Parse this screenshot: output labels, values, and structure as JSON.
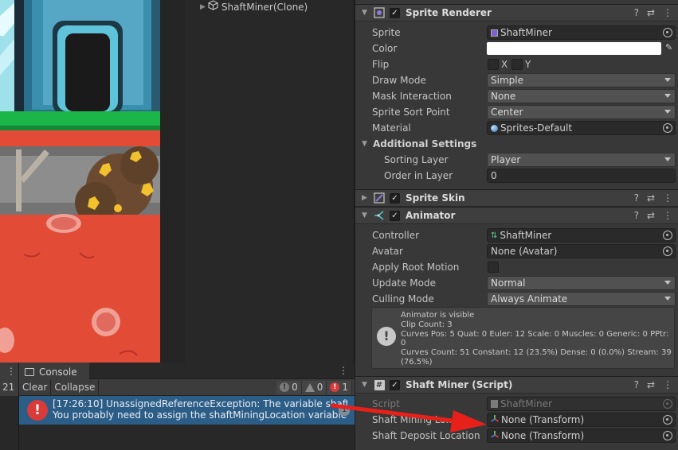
{
  "hierarchy": {
    "item": "ShaftMiner(Clone)"
  },
  "left_panel": {
    "number": "21"
  },
  "console": {
    "tab_label": "Console",
    "toolbar": {
      "clear": "Clear",
      "collapse": "Collapse",
      "log_count": "0",
      "warning_count": "0",
      "error_count": "1"
    },
    "message_line1": "[17:26:10] UnassignedReferenceException: The variable shaftMining",
    "message_line2": "You probably need to assign the shaftMiningLocation variable of the",
    "message_count": "1"
  },
  "inspector": {
    "sprite_renderer": {
      "title": "Sprite Renderer",
      "sprite_label": "Sprite",
      "sprite_value": "ShaftMiner",
      "color_label": "Color",
      "flip_label": "Flip",
      "flip_x": "X",
      "flip_y": "Y",
      "draw_mode_label": "Draw Mode",
      "draw_mode_value": "Simple",
      "mask_label": "Mask Interaction",
      "mask_value": "None",
      "sort_point_label": "Sprite Sort Point",
      "sort_point_value": "Center",
      "material_label": "Material",
      "material_value": "Sprites-Default",
      "additional_settings": "Additional Settings",
      "sorting_layer_label": "Sorting Layer",
      "sorting_layer_value": "Player",
      "order_label": "Order in Layer",
      "order_value": "0"
    },
    "sprite_skin": {
      "title": "Sprite Skin"
    },
    "animator": {
      "title": "Animator",
      "controller_label": "Controller",
      "controller_value": "ShaftMiner",
      "avatar_label": "Avatar",
      "avatar_value": "None (Avatar)",
      "root_motion_label": "Apply Root Motion",
      "update_mode_label": "Update Mode",
      "update_mode_value": "Normal",
      "culling_label": "Culling Mode",
      "culling_value": "Always Animate",
      "info": [
        "Animator is visible",
        "Clip Count: 3",
        "Curves Pos: 5 Quat: 0 Euler: 12 Scale: 0 Muscles: 0 Generic: 0 PPtr: 0",
        "Curves Count: 51 Constant: 12 (23.5%) Dense: 0 (0.0%) Stream: 39",
        "(76.5%)"
      ]
    },
    "shaft_miner": {
      "title": "Shaft Miner (Script)",
      "script_label": "Script",
      "script_value": "ShaftMiner",
      "mining_label": "Shaft Mining Lo...",
      "mining_value": "None (Transform)",
      "deposit_label": "Shaft Deposit Location",
      "deposit_value": "None (Transform)"
    }
  },
  "colors": {
    "accent_selection": "#2c5d87",
    "error_red": "#d93a3a",
    "annotation_arrow": "#e8201a"
  }
}
